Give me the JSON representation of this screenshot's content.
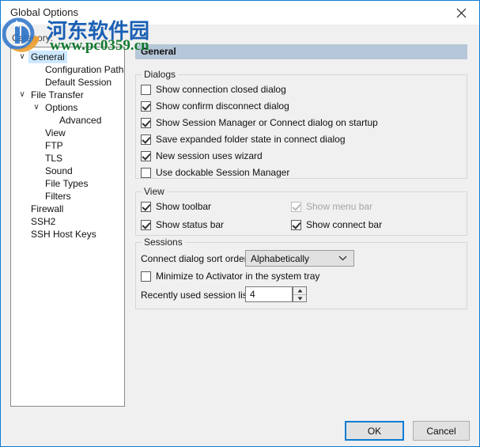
{
  "window": {
    "title": "Global Options",
    "close_icon": "close-icon"
  },
  "watermark": {
    "chinese_text": "河东软件园",
    "url_text": "www.pc0359.cn",
    "brand_blue": "#1a5fb4",
    "brand_green": "#127a2e",
    "logo_orange": "#f0a030"
  },
  "category": {
    "label": "Category:",
    "tree": [
      {
        "label": "General",
        "depth": 0,
        "chevron": "∨",
        "selected": true
      },
      {
        "label": "Configuration Paths",
        "depth": 1,
        "chevron": "",
        "selected": false
      },
      {
        "label": "Default Session",
        "depth": 1,
        "chevron": "",
        "selected": false
      },
      {
        "label": "File Transfer",
        "depth": 0,
        "chevron": "∨",
        "selected": false
      },
      {
        "label": "Options",
        "depth": 1,
        "chevron": "∨",
        "selected": false
      },
      {
        "label": "Advanced",
        "depth": 2,
        "chevron": "",
        "selected": false
      },
      {
        "label": "View",
        "depth": 1,
        "chevron": "",
        "selected": false
      },
      {
        "label": "FTP",
        "depth": 1,
        "chevron": "",
        "selected": false
      },
      {
        "label": "TLS",
        "depth": 1,
        "chevron": "",
        "selected": false
      },
      {
        "label": "Sound",
        "depth": 1,
        "chevron": "",
        "selected": false
      },
      {
        "label": "File Types",
        "depth": 1,
        "chevron": "",
        "selected": false
      },
      {
        "label": "Filters",
        "depth": 1,
        "chevron": "",
        "selected": false
      },
      {
        "label": "Firewall",
        "depth": 0,
        "chevron": "",
        "selected": false
      },
      {
        "label": "SSH2",
        "depth": 0,
        "chevron": "",
        "selected": false
      },
      {
        "label": "SSH Host Keys",
        "depth": 0,
        "chevron": "",
        "selected": false
      }
    ]
  },
  "content": {
    "header": "General",
    "dialogs_group": {
      "title": "Dialogs",
      "items": [
        {
          "label": "Show connection closed dialog",
          "checked": false,
          "disabled": false
        },
        {
          "label": "Show confirm disconnect dialog",
          "checked": true,
          "disabled": false
        },
        {
          "label": "Show Session Manager or Connect dialog on startup",
          "checked": true,
          "disabled": false
        },
        {
          "label": "Save expanded folder state in connect dialog",
          "checked": true,
          "disabled": false
        },
        {
          "label": "New session uses wizard",
          "checked": true,
          "disabled": false
        },
        {
          "label": "Use dockable Session Manager",
          "checked": false,
          "disabled": false
        }
      ]
    },
    "view_group": {
      "title": "View",
      "items": [
        {
          "label": "Show toolbar",
          "checked": true,
          "disabled": false
        },
        {
          "label": "Show menu bar",
          "checked": true,
          "disabled": true
        },
        {
          "label": "Show status bar",
          "checked": true,
          "disabled": false
        },
        {
          "label": "Show connect bar",
          "checked": true,
          "disabled": false
        }
      ]
    },
    "sessions_group": {
      "title": "Sessions",
      "sort_order_label": "Connect dialog sort order:",
      "sort_order_value": "Alphabetically",
      "sort_order_options": [
        "Alphabetically"
      ],
      "minimize_label": "Minimize to Activator in the system tray",
      "minimize_checked": false,
      "recent_label": "Recently used session list:",
      "recent_value": "4"
    }
  },
  "footer": {
    "ok_label": "OK",
    "cancel_label": "Cancel"
  }
}
